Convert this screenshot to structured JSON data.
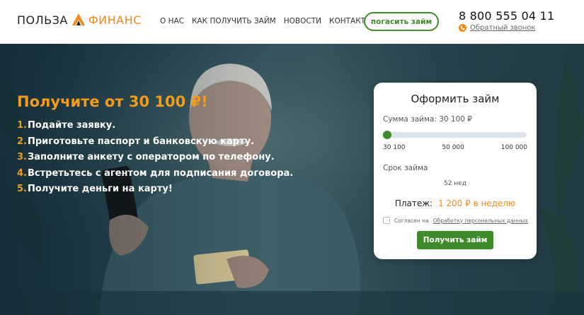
{
  "logo": {
    "word1": "ПОЛЬЗА",
    "word2": "ФИНАНС"
  },
  "nav": [
    {
      "label": "О НАС"
    },
    {
      "label": "КАК ПОЛУЧИТЬ ЗАЙМ"
    },
    {
      "label": "НОВОСТИ"
    },
    {
      "label": "КОНТАКТЫ"
    }
  ],
  "header": {
    "pay_button": "погасить займ",
    "phone": "8 800 555 04 11",
    "callback": "Обратный звонок"
  },
  "hero": {
    "title": "Получите от 30 100 ₽!",
    "steps": [
      {
        "num": "1.",
        "text": "Подайте заявку."
      },
      {
        "num": "2.",
        "text": "Приготовьте паспорт и банковскую карту."
      },
      {
        "num": "3.",
        "text": "Заполните анкету с оператором по телефону."
      },
      {
        "num": "4.",
        "text": "Встретьтесь с агентом для подписания договора."
      },
      {
        "num": "5.",
        "text": "Получите деньги на карту!"
      }
    ]
  },
  "form": {
    "title": "Оформить займ",
    "sum_label": "Сумма займа: 30 100 ₽",
    "slider": {
      "min": 30100,
      "max": 100000,
      "value": 30100
    },
    "ticks": [
      "30 100",
      "50 000",
      "100 000"
    ],
    "term_label": "Срок займа",
    "term_value": "52 нед",
    "payment_label": "Платеж:",
    "payment_amount": "1 200 ₽ в неделю",
    "consent_text": "Согласен на",
    "consent_link": "Обработку персональных данных",
    "consent_checked": false,
    "submit": "Получить займ"
  },
  "colors": {
    "accent_orange": "#f08a1a",
    "accent_green": "#3f8a2a"
  },
  "icons": {
    "logo_mark": "chevron-up-icon",
    "callback": "phone-icon"
  }
}
